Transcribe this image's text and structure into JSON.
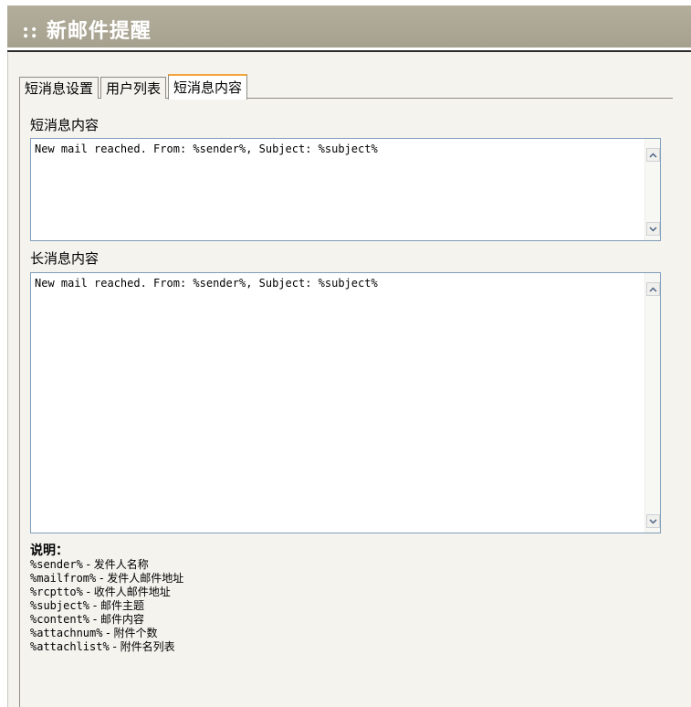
{
  "header": {
    "title": ":: 新邮件提醒"
  },
  "tabs": [
    {
      "label": "短消息设置",
      "active": false
    },
    {
      "label": "用户列表",
      "active": false
    },
    {
      "label": "短消息内容",
      "active": true
    }
  ],
  "short_message": {
    "label": "短消息内容",
    "value": "New mail reached. From: %sender%, Subject: %subject%"
  },
  "long_message": {
    "label": "长消息内容",
    "value": "New mail reached. From: %sender%, Subject: %subject%"
  },
  "help": {
    "title": "说明：",
    "lines": [
      {
        "code": "%sender%",
        "desc": " - 发件人名称"
      },
      {
        "code": "%mailfrom%",
        "desc": " - 发件人邮件地址"
      },
      {
        "code": "%rcptto%",
        "desc": " - 收件人邮件地址"
      },
      {
        "code": "%subject%",
        "desc": " - 邮件主题"
      },
      {
        "code": "%content%",
        "desc": " - 邮件内容"
      },
      {
        "code": "%attachnum%",
        "desc": " - 附件个数"
      },
      {
        "code": "%attachlist%",
        "desc": " - 附件名列表"
      }
    ]
  },
  "icons": {
    "scroll_up": "chevron-up-icon",
    "scroll_down": "chevron-down-icon"
  },
  "colors": {
    "header_bg": "#a9a493",
    "active_tab_accent": "#f3a43d",
    "panel_bg": "#f4f3ee",
    "textarea_border": "#7f9db9"
  }
}
